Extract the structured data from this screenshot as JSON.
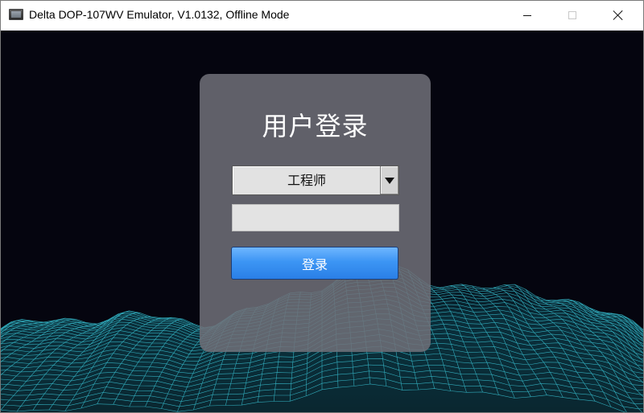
{
  "window": {
    "title": "Delta DOP-107WV Emulator, V1.0132, Offline Mode",
    "icons": {
      "app": "hmi-screen-icon",
      "minimize": "minimize-icon",
      "maximize": "maximize-icon",
      "close": "close-icon"
    }
  },
  "login": {
    "title": "用户登录",
    "user_select": {
      "value": "工程师",
      "dropdown_icon": "chevron-down-icon"
    },
    "password": {
      "value": "",
      "placeholder": ""
    },
    "button_label": "登录"
  },
  "colors": {
    "background": "#05050f",
    "panel": "#707078",
    "wave": "#38c8d8",
    "button": "#3c95f4"
  }
}
